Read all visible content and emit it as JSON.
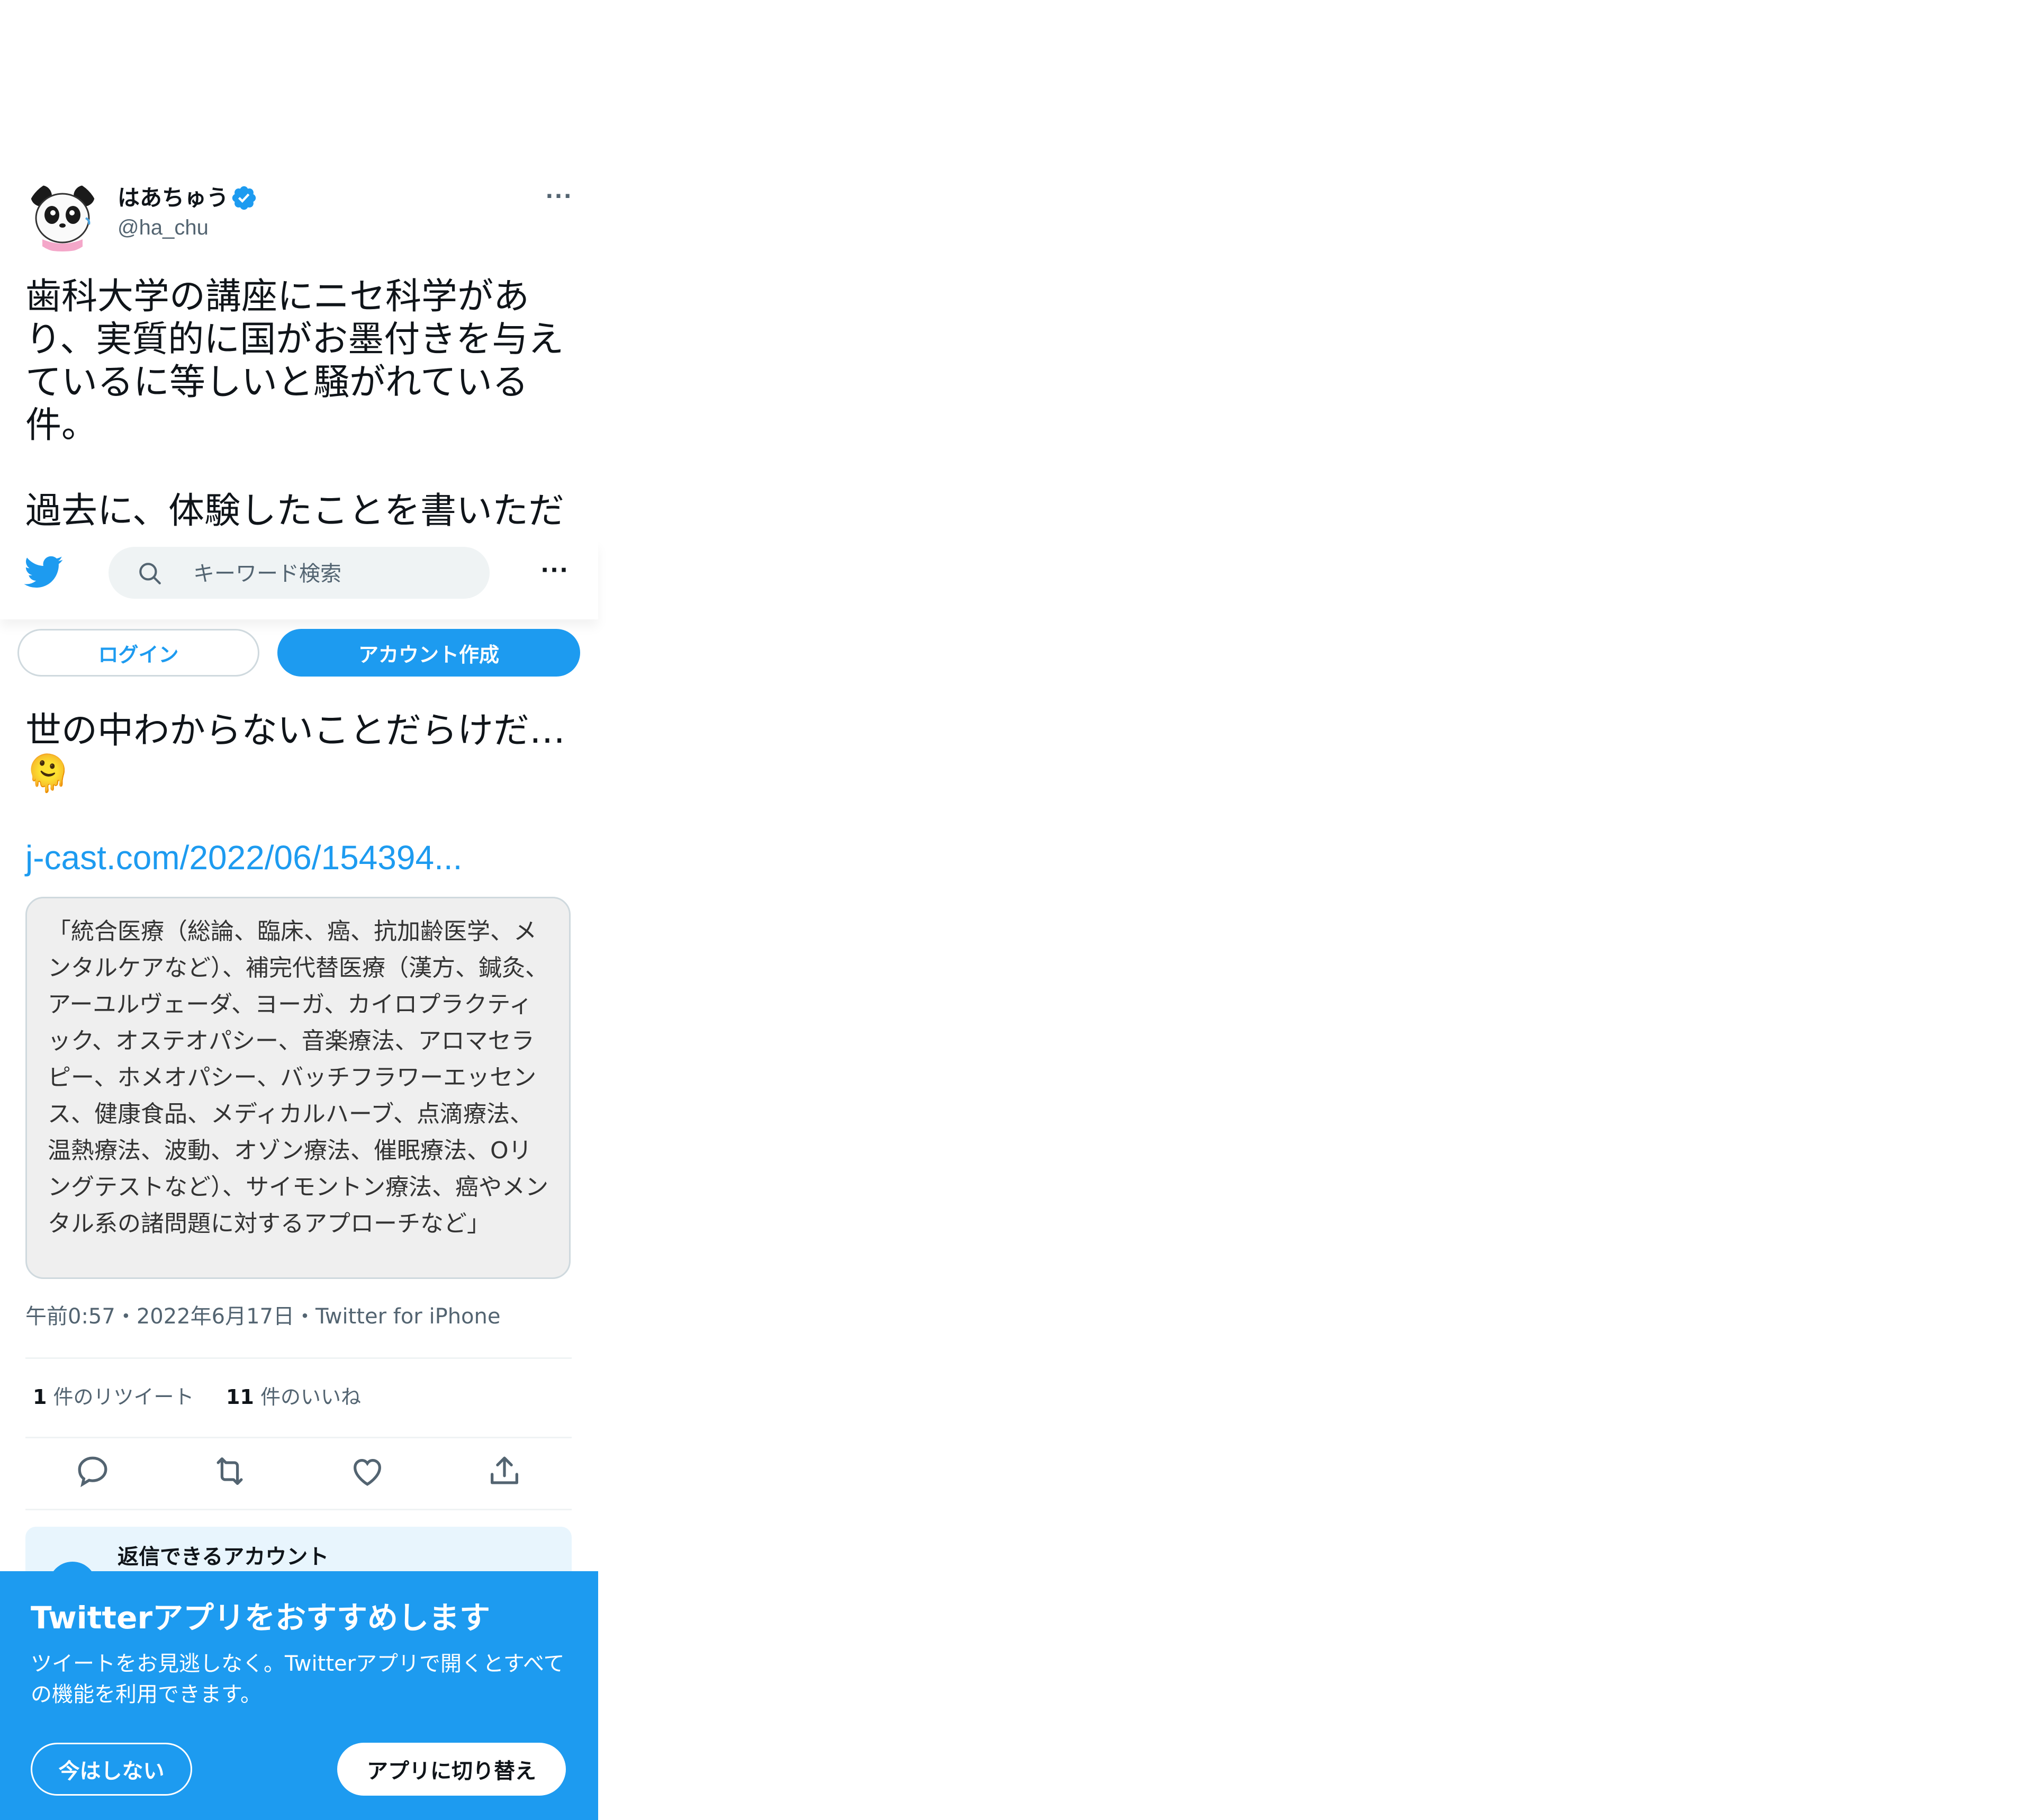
{
  "tweet": {
    "author_name": "はあちゅう",
    "author_handle": "@ha_chu",
    "more_label": "···",
    "text_visible": "歯科大学の講座にニセ科学があ\nり、実質的に国がお墨付きを与え\nているに等しいと騒がれている\n件。\n\n過去に、体験したことを書いただ",
    "text_after": "世の中わからないことだらけだ…\n🫠",
    "link": "j-cast.com/2022/06/154394...",
    "quote": "「統合医療（総論、臨床、癌、抗加齢医学、メンタルケアなど）、補完代替医療（漢方、鍼灸、アーユルヴェーダ、ヨーガ、カイロプラクティック、オステオパシー、音楽療法、アロマセラピー、ホメオパシー、バッチフラワーエッセンス、健康食品、メディカルハーブ、点滴療法、温熱療法、波動、オゾン療法、催眠療法、Oリングテストなど）、サイモントン療法、癌やメンタル系の諸問題に対するアプローチなど」",
    "meta": "午前0:57・2022年6月17日・Twitter for iPhone",
    "retweet_count": "1",
    "retweet_label": "件のリツイート",
    "like_count": "11",
    "like_label": "件のいいね",
    "reply_restriction_title": "返信できるアカウント"
  },
  "nav": {
    "search_placeholder": "キーワード検索",
    "more_label": "···",
    "login_label": "ログイン",
    "signup_label": "アカウント作成"
  },
  "banner": {
    "title": "Twitterアプリをおすすめします",
    "description": "ツイートをお見逃しなく。Twitterアプリで開くとすべての機能を利用できます。",
    "not_now_label": "今はしない",
    "switch_label": "アプリに切り替え"
  },
  "colors": {
    "accent": "#1d9bf0",
    "text_primary": "#0f1419",
    "text_secondary": "#536471",
    "quote_bg": "#efefef"
  },
  "icons": [
    "avatar-panda",
    "verified-badge-icon",
    "twitter-bird-icon",
    "search-icon",
    "more-icon",
    "reply-icon",
    "retweet-icon",
    "like-icon",
    "share-icon"
  ]
}
